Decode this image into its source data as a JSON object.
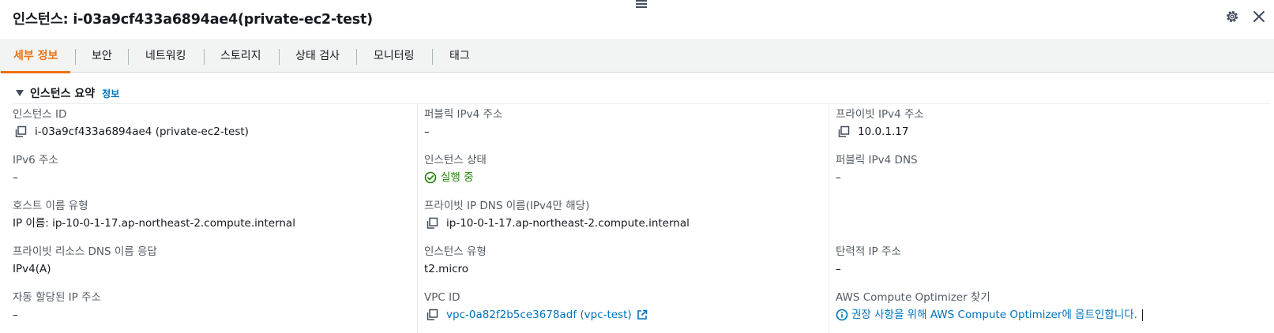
{
  "header": {
    "title": "인스턴스: i-03a9cf433a6894ae4(private-ec2-test)",
    "icons": {
      "drag": "drag-handle-icon",
      "settings": "gear-icon",
      "close": "close-icon"
    }
  },
  "tabs": [
    {
      "label": "세부 정보",
      "active": true
    },
    {
      "label": "보안"
    },
    {
      "label": "네트워킹"
    },
    {
      "label": "스토리지"
    },
    {
      "label": "상태 검사"
    },
    {
      "label": "모니터링"
    },
    {
      "label": "태그"
    }
  ],
  "section": {
    "title": "인스턴스 요약",
    "info_link": "정보"
  },
  "fields": {
    "instance_id": {
      "label": "인스턴스 ID",
      "value": "i-03a9cf433a6894ae4 (private-ec2-test)"
    },
    "ipv6": {
      "label": "IPv6 주소",
      "value": "–"
    },
    "hostname_type": {
      "label": "호스트 이름 유형",
      "value": "IP 이름: ip-10-0-1-17.ap-northeast-2.compute.internal"
    },
    "private_dns_answer": {
      "label": "프라이빗 리소스 DNS 이름 응답",
      "value": "IPv4(A)"
    },
    "auto_ip": {
      "label": "자동 할당된 IP 주소",
      "value": "–"
    },
    "public_ipv4": {
      "label": "퍼블릭 IPv4 주소",
      "value": "–"
    },
    "instance_state": {
      "label": "인스턴스 상태",
      "value": "실행 중"
    },
    "private_ip_dns": {
      "label": "프라이빗 IP DNS 이름(IPv4만 해당)",
      "value": "ip-10-0-1-17.ap-northeast-2.compute.internal"
    },
    "instance_type": {
      "label": "인스턴스 유형",
      "value": "t2.micro"
    },
    "vpc_id": {
      "label": "VPC ID",
      "value": "vpc-0a82f2b5ce3678adf (vpc-test)"
    },
    "private_ipv4": {
      "label": "프라이빗 IPv4 주소",
      "value": "10.0.1.17"
    },
    "public_dns": {
      "label": "퍼블릭 IPv4 DNS",
      "value": "–"
    },
    "elastic_ip": {
      "label": "탄력적 IP 주소",
      "value": "–"
    },
    "compute_optimizer": {
      "label": "AWS Compute Optimizer 찾기",
      "value": "권장 사항을 위해 AWS Compute Optimizer에 옵트인합니다."
    }
  },
  "colors": {
    "accent": "#ec7211",
    "link": "#0073bb",
    "success": "#1d8102",
    "label": "#545b64",
    "text": "#16191f"
  }
}
